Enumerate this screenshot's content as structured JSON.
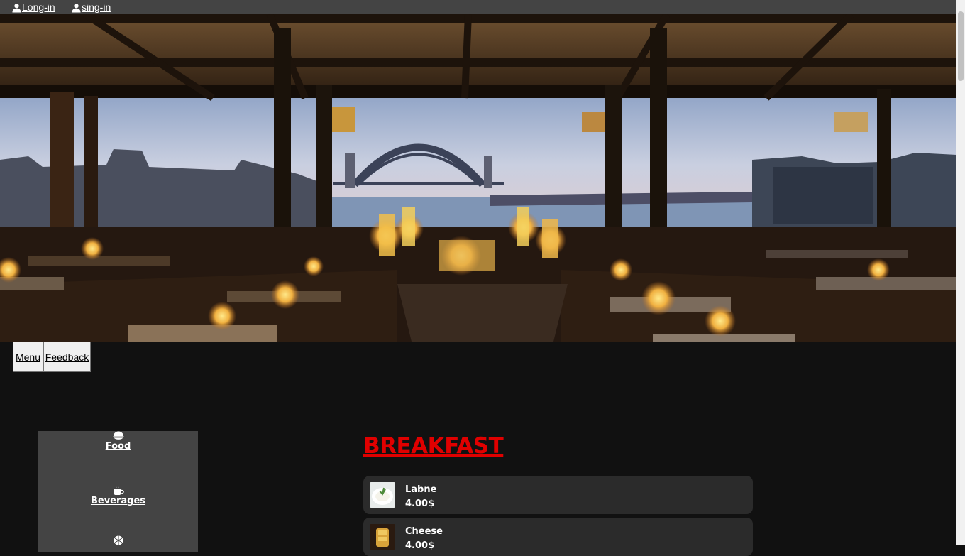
{
  "header": {
    "links": [
      {
        "label": "Long-in",
        "icon": "user-icon"
      },
      {
        "label": "sing-in",
        "icon": "user-icon"
      }
    ]
  },
  "hero": {
    "image": "restaurant-harbour-view-photo"
  },
  "nav": {
    "tabs": [
      {
        "label": "Menu"
      },
      {
        "label": "Feedback"
      }
    ]
  },
  "sidebar": {
    "categories": [
      {
        "label": "Food",
        "icon": "bowl-icon"
      },
      {
        "label": "Beverages",
        "icon": "coffee-cup-icon"
      },
      {
        "label": "",
        "icon": "ball-icon"
      }
    ]
  },
  "menu": {
    "section_title": "BREAKFAST",
    "items": [
      {
        "name": "Labne",
        "price": "4.00$",
        "thumb": "labne-photo"
      },
      {
        "name": "Cheese",
        "price": "4.00$",
        "thumb": "cheese-photo"
      }
    ]
  },
  "colors": {
    "page_bg": "#111111",
    "topbar_bg": "#444444",
    "sidebar_bg": "#444444",
    "item_bg": "#2b2b2b",
    "title_red": "#e00000"
  }
}
